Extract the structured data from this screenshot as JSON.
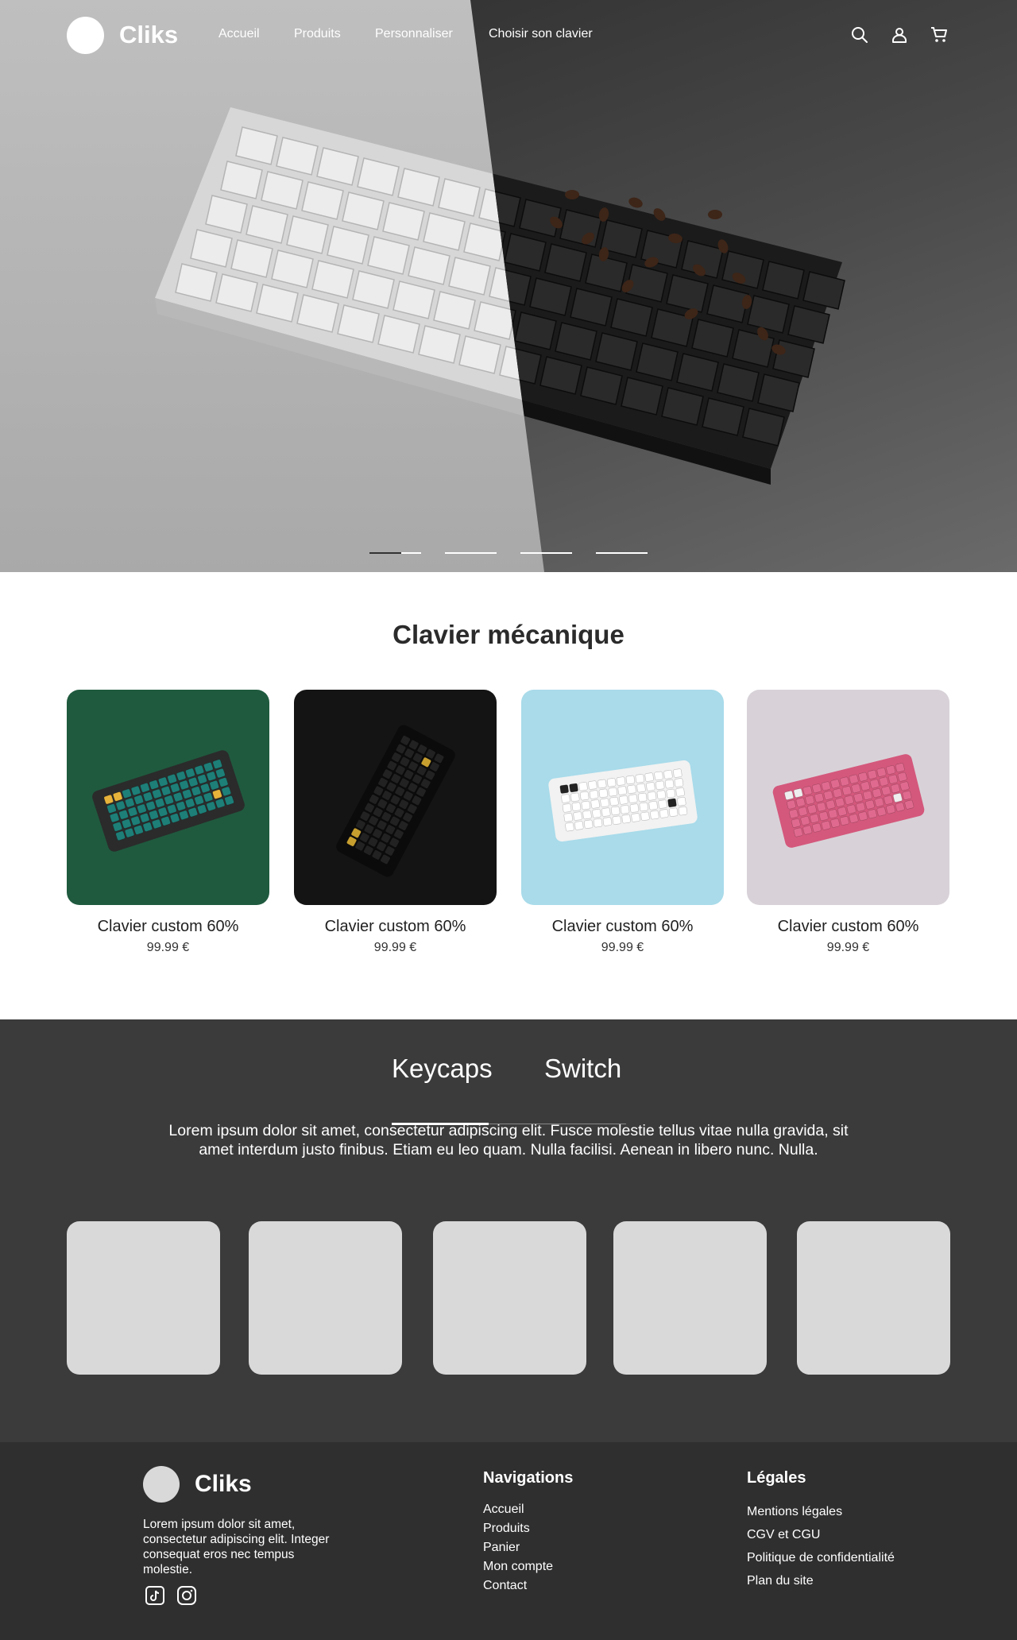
{
  "header": {
    "brand": "Cliks",
    "nav": [
      {
        "label": "Accueil"
      },
      {
        "label": "Produits"
      },
      {
        "label": "Personnaliser"
      },
      {
        "label": "Choisir son clavier"
      }
    ],
    "icons": [
      "search-icon",
      "account-icon",
      "cart-icon"
    ]
  },
  "hero": {
    "slides_total": 4,
    "active_slide": 1,
    "active_progress": 0.62
  },
  "products": {
    "title": "Clavier mécanique",
    "items": [
      {
        "name": "Clavier custom 60%",
        "price": "99.99 €",
        "bg": "#1f5a3e"
      },
      {
        "name": "Clavier custom 60%",
        "price": "99.99 €",
        "bg": "#141414"
      },
      {
        "name": "Clavier custom 60%",
        "price": "99.99 €",
        "bg": "#a9dbea"
      },
      {
        "name": "Clavier custom 60%",
        "price": "99.99 €",
        "bg": "#d8d2d8"
      }
    ]
  },
  "accessories": {
    "tabs": [
      {
        "label": "Keycaps"
      },
      {
        "label": "Switch"
      }
    ],
    "active_tab": 0,
    "description": "Lorem ipsum dolor sit amet, consectetur adipiscing elit. Fusce molestie tellus vitae nulla gravida, sit amet interdum justo finibus. Etiam eu leo quam. Nulla facilisi. Aenean in libero nunc. Nulla.",
    "tile_count": 5
  },
  "footer": {
    "brand": "Cliks",
    "description": "Lorem ipsum dolor sit amet, consectetur adipiscing elit. Integer consequat eros nec tempus molestie.",
    "social": [
      "tiktok-icon",
      "instagram-icon"
    ],
    "nav_title": "Navigations",
    "nav_links": [
      "Accueil",
      "Produits",
      "Panier",
      "Mon compte",
      "Contact"
    ],
    "legal_title": "Légales",
    "legal_links": [
      "Mentions légales",
      "CGV et CGU",
      "Politique de confidentialité",
      "Plan du site"
    ]
  },
  "colors": {
    "dark_section": "#3b3b3b",
    "footer": "#2f2f2f",
    "tile": "#d9d9d9"
  }
}
